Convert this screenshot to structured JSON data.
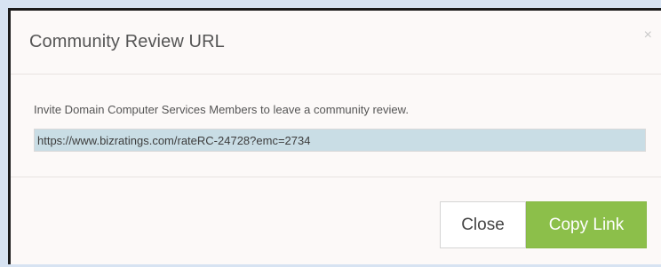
{
  "modal": {
    "title": "Community Review URL",
    "close_icon": "×",
    "invite_text": "Invite Domain Computer Services Members to leave a community review.",
    "url_value": "https://www.bizratings.com/rateRC-24728?emc=2734"
  },
  "footer": {
    "close_label": "Close",
    "copy_label": "Copy Link"
  },
  "colors": {
    "background": "#d7e3f2",
    "modal_bg": "#fcf9f8",
    "url_highlight": "#c9dde5",
    "copy_button": "#8cbf4a"
  },
  "icons": {
    "close": "close-icon"
  }
}
